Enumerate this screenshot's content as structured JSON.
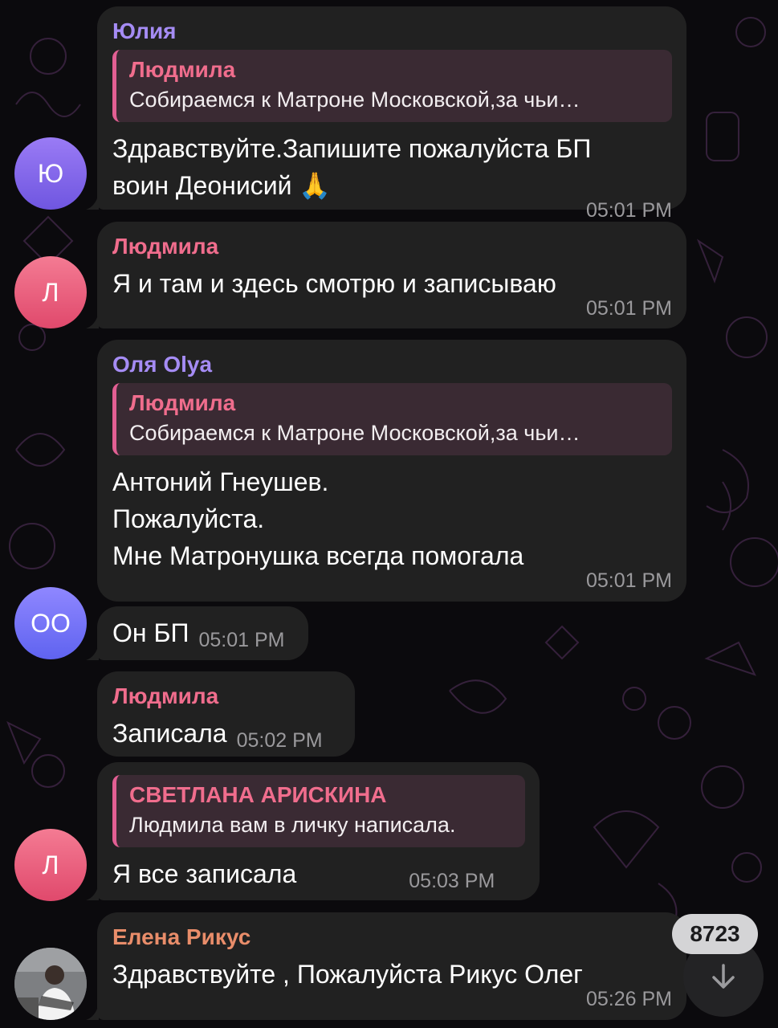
{
  "messages": [
    {
      "sender": "Юлия",
      "reply": {
        "name": "Людмила",
        "text": "Собираемся к Матроне Московской,за чьи…"
      },
      "text": "Здравствуйте.Запишите пожалуйста БП\nвоин Деонисий 🙏",
      "time": "05:01 PM",
      "avatar_letter": "Ю"
    },
    {
      "sender": "Людмила",
      "text": "Я и там и здесь смотрю и записываю",
      "time": "05:01 PM",
      "avatar_letter": "Л"
    },
    {
      "sender": "Оля Olya",
      "reply": {
        "name": "Людмила",
        "text": "Собираемся к Матроне Московской,за чьи…"
      },
      "text": "Антоний Гнеушев.\nПожалуйста.\nМне Матронушка всегда помогала",
      "time": "05:01 PM"
    },
    {
      "text": "Он БП",
      "time": "05:01 PM",
      "avatar_letter": "ОО"
    },
    {
      "sender": "Людмила",
      "text": "Записала",
      "time": "05:02 PM"
    },
    {
      "reply": {
        "name": "СВЕТЛАНА АРИСКИНА",
        "text": "Людмила вам в личку написала."
      },
      "text": "Я все записала",
      "time": "05:03 PM",
      "avatar_letter": "Л"
    },
    {
      "sender": "Елена Рикус",
      "text": "Здравствуйте , Пожалуйста Рикус Олег",
      "time": "05:26 PM"
    }
  ],
  "unread_badge": "8723",
  "colors": {
    "background": "#0b0a0d",
    "bubble": "#212121",
    "sender_purple": "#a58cf4",
    "sender_pink": "#f06d8d",
    "sender_orange": "#e98d6a",
    "time": "#9a999c"
  },
  "icons": {
    "scroll_down": "arrow-down-icon"
  }
}
